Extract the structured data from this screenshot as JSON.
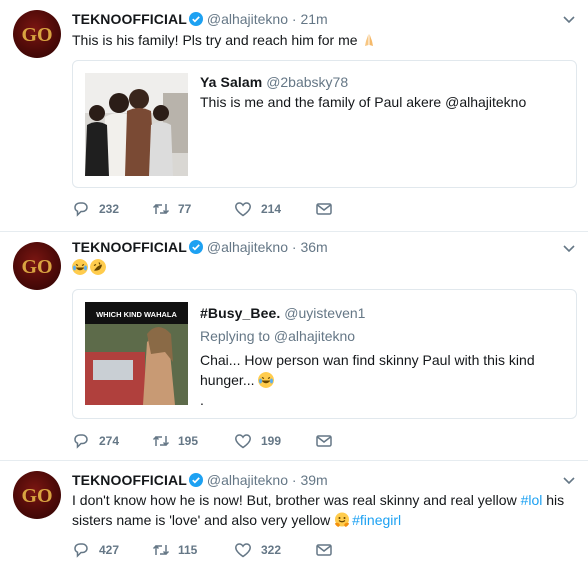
{
  "tweets": [
    {
      "author": "TEKNOOFFICIAL",
      "handle": "@alhajitekno",
      "separator": "·",
      "time": "21m",
      "text": "This is his family! Pls try and reach him for me",
      "text_emoji": "folded-hands",
      "quote": {
        "name": "Ya Salam",
        "handle": "@2babsky78",
        "text": "This is me and the family of Paul akere @alhajitekno"
      },
      "replies": "232",
      "retweets": "77",
      "likes": "214"
    },
    {
      "author": "TEKNOOFFICIAL",
      "handle": "@alhajitekno",
      "separator": "·",
      "time": "36m",
      "text_emojis": [
        "joy",
        "rofl"
      ],
      "quote": {
        "name": "#Busy_Bee.",
        "handle": "@uyisteven1",
        "replying_to": "Replying to @alhajitekno",
        "line1": "Chai... How person wan find skinny Paul with this kind",
        "line2": "hunger...",
        "line3": ".",
        "image_caption": "WHICH KIND WAHALA"
      },
      "replies": "274",
      "retweets": "195",
      "likes": "199"
    },
    {
      "author": "TEKNOOFFICIAL",
      "handle": "@alhajitekno",
      "separator": "·",
      "time": "39m",
      "line1_a": "I don't know how he is now! But, brother was real skinny and real yellow ",
      "hashtag1": "#lol",
      "line1_b": " his",
      "line2_a": "sisters name is 'love' and also very yellow ",
      "hashtag2": "#finegirl",
      "replies": "427",
      "retweets": "115",
      "likes": "322"
    }
  ],
  "colors": {
    "text": "#14171a",
    "muted": "#657786",
    "link": "#1da1f2",
    "border": "#e6ecf0",
    "verified": "#1da1f2",
    "avatar": "#5a0d0a",
    "avatar_logo": "#d9a441"
  },
  "icons": [
    "reply-icon",
    "retweet-icon",
    "like-icon",
    "direct-message-icon",
    "verified-badge-icon",
    "caret-down-icon"
  ]
}
